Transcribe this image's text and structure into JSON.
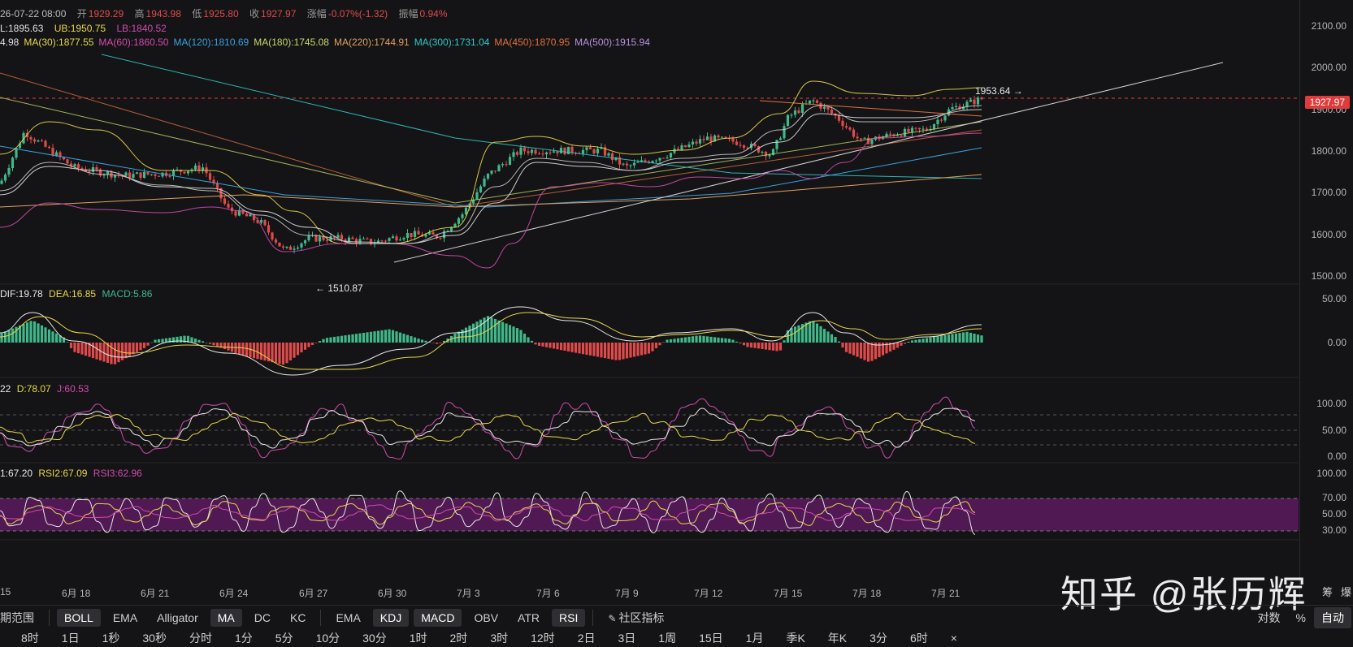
{
  "header": {
    "date": "26-07-22 08:00",
    "open_label": "开",
    "open": "1929.29",
    "high_label": "高",
    "high": "1943.98",
    "low_label": "低",
    "low": "1925.80",
    "close_label": "收",
    "close": "1927.97",
    "change_label": "涨幅",
    "change": "-0.07%(-1.32)",
    "amplitude_label": "振幅",
    "amplitude": "0.94%"
  },
  "boll": {
    "mid": "L:1895.63",
    "ub": "UB:1950.75",
    "lb": "LB:1840.52"
  },
  "ma": [
    {
      "text": "4.98",
      "color": "#e0e0e0"
    },
    {
      "text": "MA(30):1877.55",
      "color": "#e8d84a"
    },
    {
      "text": "MA(60):1860.50",
      "color": "#d24bb0"
    },
    {
      "text": "MA(120):1810.69",
      "color": "#3aa0e0"
    },
    {
      "text": "MA(180):1745.08",
      "color": "#c6d86a"
    },
    {
      "text": "MA(220):1744.91",
      "color": "#e0a060"
    },
    {
      "text": "MA(300):1731.04",
      "color": "#30c8c8"
    },
    {
      "text": "MA(450):1870.95",
      "color": "#e07040"
    },
    {
      "text": "MA(500):1915.94",
      "color": "#b890e0"
    }
  ],
  "macd": {
    "dif": "DIF:19.78",
    "dea": "DEA:16.85",
    "macd": "MACD:5.86"
  },
  "kdj": {
    "k": "22",
    "d": "D:78.07",
    "j": "J:60.53"
  },
  "rsi": {
    "rsi1": "1:67.20",
    "rsi2": "RSI2:67.09",
    "rsi3": "RSI3:62.96"
  },
  "price_axis": [
    "2100.00",
    "2000.00",
    "1900.00",
    "1800.00",
    "1700.00",
    "1600.00",
    "1500.00"
  ],
  "current_price": "1927.97",
  "macd_axis": [
    "50.00",
    "0.00"
  ],
  "kdj_axis": [
    "100.00",
    "50.00",
    "0.00"
  ],
  "rsi_axis": [
    "100.00",
    "70.00",
    "50.00",
    "30.00"
  ],
  "annotations": {
    "high": "1953.64 →",
    "low": "← 1510.87"
  },
  "dates": [
    "15",
    "6月 18",
    "6月 21",
    "6月 24",
    "6月 27",
    "6月 30",
    "7月 3",
    "7月 6",
    "7月 9",
    "7月 12",
    "7月 15",
    "7月 18",
    "7月 21"
  ],
  "indicator_bar": {
    "range": "期范围",
    "main": [
      {
        "label": "BOLL",
        "active": true
      },
      {
        "label": "EMA",
        "active": false
      },
      {
        "label": "Alligator",
        "active": false
      },
      {
        "label": "MA",
        "active": true
      },
      {
        "label": "DC",
        "active": false
      },
      {
        "label": "KC",
        "active": false
      }
    ],
    "sub": [
      {
        "label": "EMA",
        "active": false
      },
      {
        "label": "KDJ",
        "active": true
      },
      {
        "label": "MACD",
        "active": true
      },
      {
        "label": "OBV",
        "active": false
      },
      {
        "label": "ATR",
        "active": false
      },
      {
        "label": "RSI",
        "active": true
      }
    ],
    "community": "社区指标"
  },
  "periods": [
    "8时",
    "1日",
    "1秒",
    "30秒",
    "分时",
    "1分",
    "5分",
    "10分",
    "30分",
    "1时",
    "2时",
    "3时",
    "12时",
    "2日",
    "3日",
    "1周",
    "15日",
    "1月",
    "季K",
    "年K",
    "3分",
    "6时",
    "×"
  ],
  "right_controls": {
    "log": "对数",
    "percent": "%",
    "auto": "自动",
    "chip": "筹",
    "liq": "爆"
  },
  "watermark": "知乎 @张历辉"
}
